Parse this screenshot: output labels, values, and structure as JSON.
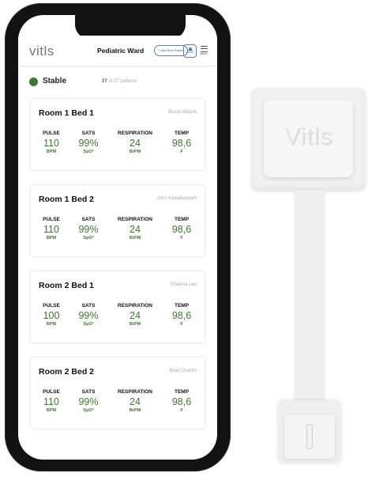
{
  "header": {
    "logo": "vitls",
    "ward_title": "Pediatric Ward",
    "new_patient_label": "+ Add New Patient",
    "alerts_label": "Alerts",
    "menu_label": "Menu"
  },
  "status": {
    "label": "Stable",
    "count_current": "27",
    "count_rest": "of 27 patients",
    "color": "#3c7a2f"
  },
  "vital_labels": [
    "PULSE",
    "SATS",
    "RESPIRATION",
    "TEMP"
  ],
  "cards": [
    {
      "room": "Room 1  Bed 1",
      "patient": "Bruce Wayne",
      "vitals": [
        {
          "value": "110",
          "unit": "BPM"
        },
        {
          "value": "99%",
          "unit": "SpO²"
        },
        {
          "value": "24",
          "unit": "BrPM"
        },
        {
          "value": "98,6",
          "unit": "F"
        }
      ]
    },
    {
      "room": "Room 1  Bed 2",
      "patient": "John Kawabayashi",
      "vitals": [
        {
          "value": "110",
          "unit": "BPM"
        },
        {
          "value": "99%",
          "unit": "SpO²"
        },
        {
          "value": "24",
          "unit": "BrPM"
        },
        {
          "value": "98,6",
          "unit": "F"
        }
      ]
    },
    {
      "room": "Room 2  Bed 1",
      "patient": "Shawna Lee",
      "vitals": [
        {
          "value": "100",
          "unit": "BPM"
        },
        {
          "value": "99%",
          "unit": "SpO²"
        },
        {
          "value": "24",
          "unit": "BrPM"
        },
        {
          "value": "98,6",
          "unit": "F"
        }
      ]
    },
    {
      "room": "Room 2  Bed 2",
      "patient": "Brian Overlin",
      "vitals": [
        {
          "value": "110",
          "unit": "BPM"
        },
        {
          "value": "99%",
          "unit": "SpO²"
        },
        {
          "value": "24",
          "unit": "BrPM"
        },
        {
          "value": "98,6",
          "unit": "F"
        }
      ]
    }
  ],
  "device": {
    "logo": "Vitls"
  }
}
